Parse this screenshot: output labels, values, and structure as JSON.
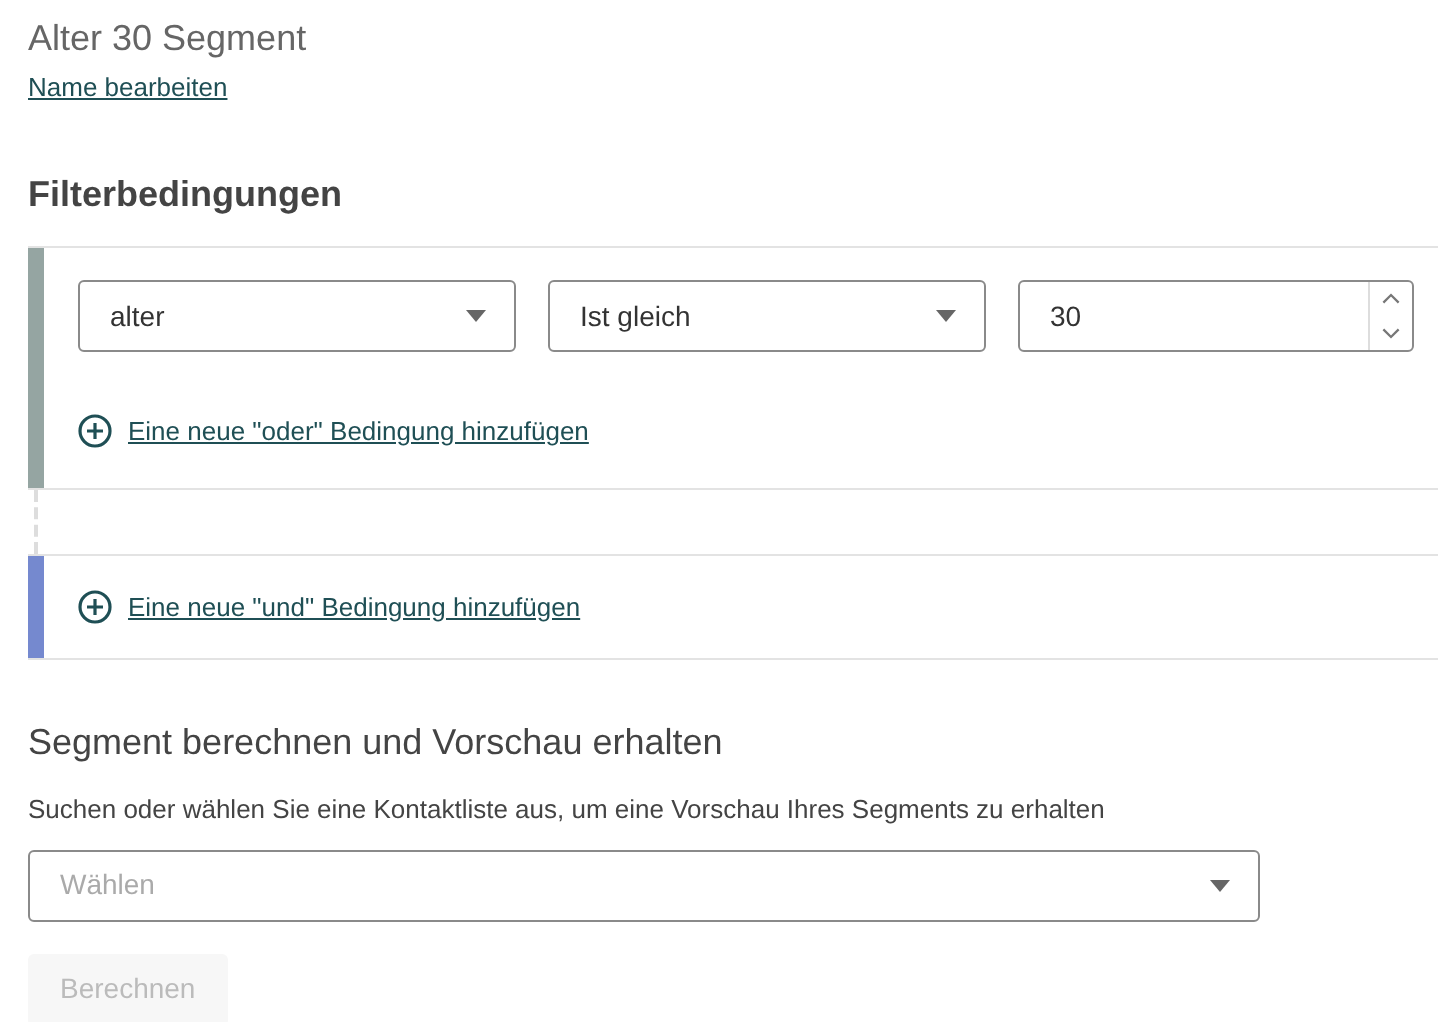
{
  "segment": {
    "title": "Alter 30 Segment",
    "edit_link": "Name bearbeiten"
  },
  "filter": {
    "heading": "Filterbedingungen",
    "groups": [
      {
        "kind": "condition",
        "color": "#95a5a2",
        "field": "alter",
        "operator": "Ist gleich",
        "value": "30",
        "add_link": "Eine neue \"oder\" Bedingung hinzufügen"
      },
      {
        "kind": "add",
        "color": "#7589cf",
        "add_link": "Eine neue \"und\" Bedingung hinzufügen"
      }
    ]
  },
  "preview": {
    "heading": "Segment berechnen und Vorschau erhalten",
    "description": "Suchen oder wählen Sie eine Kontaktliste aus, um eine Vorschau Ihres Segments zu erhalten",
    "select": {
      "placeholder": "Wählen"
    },
    "button": {
      "label": "Berechnen",
      "disabled": true
    }
  }
}
